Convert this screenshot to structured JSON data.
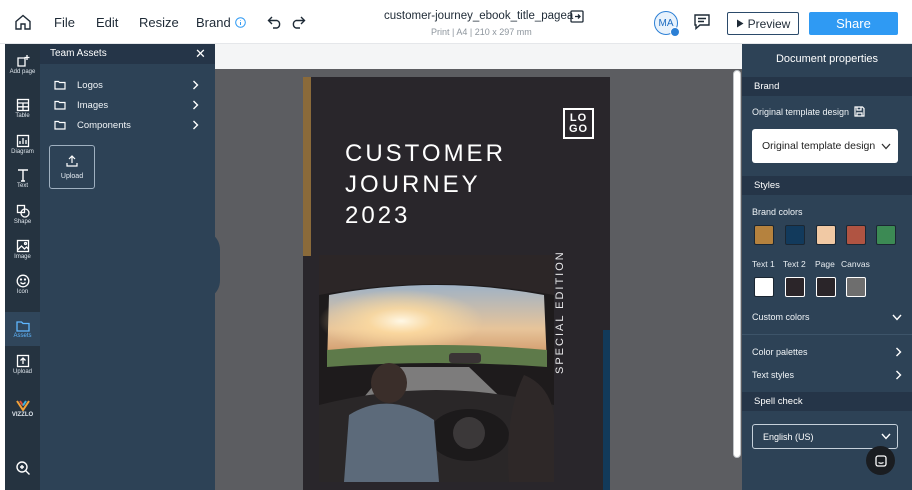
{
  "menu": {
    "file": "File",
    "edit": "Edit",
    "resize": "Resize",
    "brand": "Brand"
  },
  "document": {
    "title": "customer-journey_ebook_title_pagea",
    "subtitle": "Print | A4 | 210 x 297 mm"
  },
  "user": {
    "initials": "MA"
  },
  "actions": {
    "preview": "Preview",
    "share": "Share"
  },
  "rail": {
    "add_page": "Add page",
    "table": "Table",
    "diagram": "Diagram",
    "text": "Text",
    "shape": "Shape",
    "image": "Image",
    "icon": "Icon",
    "assets": "Assets",
    "upload": "Upload",
    "brand_logo": "VIZZLO"
  },
  "assets_panel": {
    "title": "Team Assets",
    "folders": [
      {
        "name": "Logos"
      },
      {
        "name": "Images"
      },
      {
        "name": "Components"
      }
    ],
    "upload_label": "Upload"
  },
  "cover": {
    "logo_top": "LO",
    "logo_bottom": "GO",
    "title_lines": [
      "CUSTOMER",
      "JOURNEY",
      "2023"
    ],
    "vertical_text": "SPECIAL EDITION"
  },
  "properties": {
    "title": "Document properties",
    "brand_section": "Brand",
    "template_label": "Original template design",
    "template_value": "Original template design",
    "styles_section": "Styles",
    "brand_colors_label": "Brand colors",
    "brand_colors": [
      "#b5823e",
      "#123a5c",
      "#f1c9a4",
      "#b05442",
      "#3c8a54"
    ],
    "text_colors_labels": {
      "text1": "Text 1",
      "text2": "Text 2",
      "page": "Page",
      "canvas": "Canvas"
    },
    "text_colors": [
      "#ffffff",
      "#2b2529",
      "#2a2529",
      "#6e6e6e"
    ],
    "custom_colors": "Custom colors",
    "color_palettes": "Color palettes",
    "text_styles": "Text styles",
    "spell_section": "Spell check",
    "language": "English (US)"
  }
}
